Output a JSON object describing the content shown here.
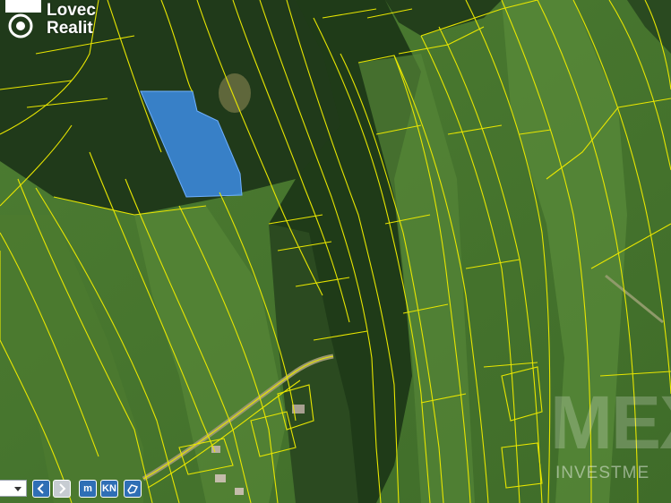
{
  "logo": {
    "line1": "Lovec",
    "line2": "Realit",
    "icon": "target-pin-icon"
  },
  "watermark": {
    "big": "MEX",
    "small": "INVESTME"
  },
  "map_toolbar": {
    "select_value": "",
    "prev_icon": "chevron-left-icon",
    "next_icon": "chevron-right-icon",
    "measure_label": "m",
    "cadastre_label": "KN",
    "area_icon": "polygon-measure-icon"
  },
  "colors": {
    "parcel_lines": "#e8e600",
    "highlight_fill": "#3d8de6",
    "meadow": "#4f7f34",
    "forest": "#24401c",
    "toolbar_blue": "#2f6fb5"
  }
}
